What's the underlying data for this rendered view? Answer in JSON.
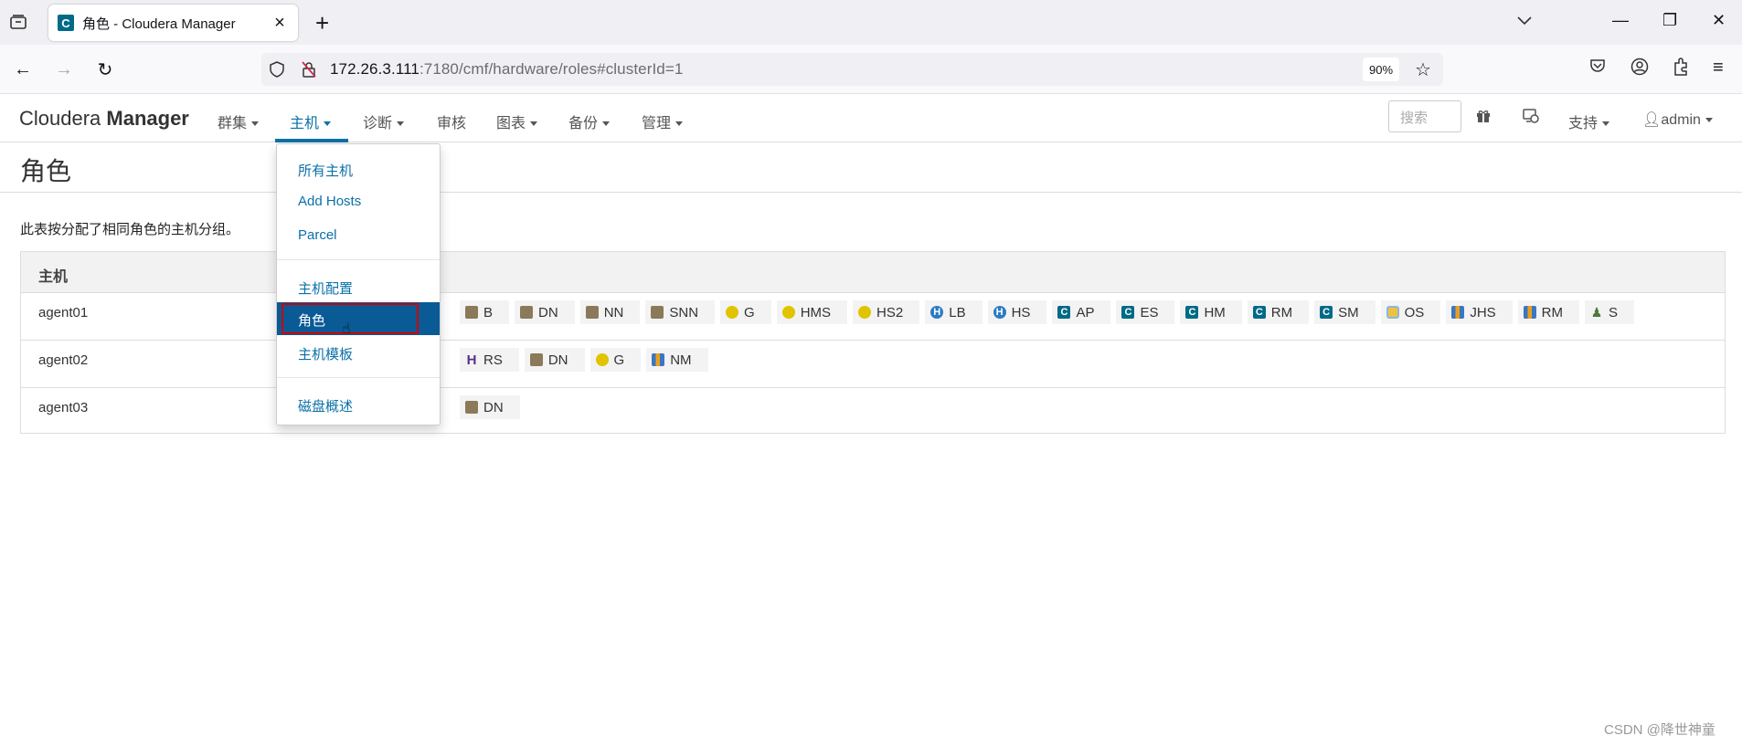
{
  "browser": {
    "tab_title": "角色 - Cloudera Manager",
    "favicon_letter": "C",
    "url_host": "172.26.3.111",
    "url_rest": ":7180/cmf/hardware/roles#clusterId=1",
    "zoom": "90%"
  },
  "app": {
    "brand_light": "Cloudera ",
    "brand_bold": "Manager",
    "menus": [
      "群集",
      "主机",
      "诊断",
      "审核",
      "图表",
      "备份",
      "管理"
    ],
    "active_menu": "主机",
    "search_placeholder": "搜索",
    "support": "支持",
    "user": "admin"
  },
  "dropdown": {
    "items": [
      "所有主机",
      "Add Hosts",
      "Parcel",
      "主机配置",
      "角色",
      "主机模板",
      "磁盘概述"
    ],
    "selected": "角色"
  },
  "page": {
    "title": "角色",
    "description": "此表按分配了相同角色的主机分组。",
    "column_header": "主机"
  },
  "table": {
    "rows": [
      {
        "host": "agent01",
        "roles": [
          {
            "label": "B",
            "icon": "hdfs-icon"
          },
          {
            "label": "DN",
            "icon": "hdfs-icon"
          },
          {
            "label": "NN",
            "icon": "hdfs-icon"
          },
          {
            "label": "SNN",
            "icon": "hdfs-icon"
          },
          {
            "label": "G",
            "icon": "hive-icon"
          },
          {
            "label": "HMS",
            "icon": "hive-icon"
          },
          {
            "label": "HS2",
            "icon": "hive-icon"
          },
          {
            "label": "LB",
            "icon": "hue-icon"
          },
          {
            "label": "HS",
            "icon": "hue-icon"
          },
          {
            "label": "AP",
            "icon": "cloudera-icon"
          },
          {
            "label": "ES",
            "icon": "cloudera-icon"
          },
          {
            "label": "HM",
            "icon": "cloudera-icon"
          },
          {
            "label": "RM",
            "icon": "cloudera-icon"
          },
          {
            "label": "SM",
            "icon": "cloudera-icon"
          },
          {
            "label": "OS",
            "icon": "oozie-icon"
          },
          {
            "label": "JHS",
            "icon": "yarn-icon"
          },
          {
            "label": "RM",
            "icon": "yarn-icon"
          },
          {
            "label": "S",
            "icon": "sqoop-icon"
          }
        ]
      },
      {
        "host": "agent02",
        "roles": [
          {
            "label": "RS",
            "icon": "hbase-icon"
          },
          {
            "label": "DN",
            "icon": "hdfs-icon"
          },
          {
            "label": "G",
            "icon": "hive-icon"
          },
          {
            "label": "NM",
            "icon": "yarn-icon"
          }
        ]
      },
      {
        "host": "agent03",
        "roles": [
          {
            "label": "DN",
            "icon": "hdfs-icon"
          }
        ]
      }
    ]
  },
  "watermark": "CSDN @降世神童"
}
